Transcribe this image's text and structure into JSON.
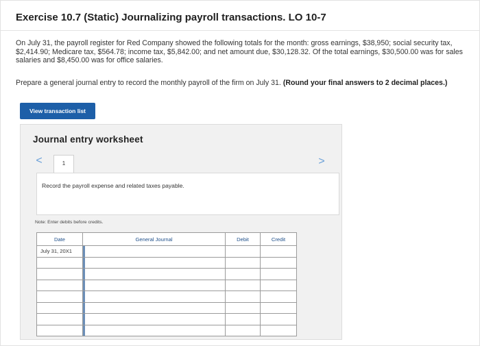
{
  "exercise": {
    "title": "Exercise 10.7 (Static) Journalizing payroll transactions. LO 10-7",
    "paragraph1": "On July 31, the payroll register for Red Company showed the following totals for the month: gross earnings, $38,950; social security tax, $2,414.90; Medicare tax, $564.78; income tax, $5,842.00; and net amount due, $30,128.32. Of the total earnings, $30,500.00 was for sales salaries and $8,450.00 was for office salaries.",
    "paragraph2": "Prepare a general journal entry to record the monthly payroll of the firm on July 31.",
    "paragraph2_bold": "(Round your final answers to 2 decimal places.)",
    "view_button": "View transaction list"
  },
  "worksheet": {
    "title": "Journal entry worksheet",
    "prev_symbol": "<",
    "next_symbol": ">",
    "tab_label": "1",
    "instruction": "Record the payroll expense and related taxes payable.",
    "note": "Note: Enter debits before credits.",
    "columns": {
      "date": "Date",
      "account": "General Journal",
      "debit": "Debit",
      "credit": "Credit"
    },
    "rows": [
      {
        "date": "July 31, 20X1",
        "account": "",
        "debit": "",
        "credit": ""
      },
      {
        "date": "",
        "account": "",
        "debit": "",
        "credit": ""
      },
      {
        "date": "",
        "account": "",
        "debit": "",
        "credit": ""
      },
      {
        "date": "",
        "account": "",
        "debit": "",
        "credit": ""
      },
      {
        "date": "",
        "account": "",
        "debit": "",
        "credit": ""
      },
      {
        "date": "",
        "account": "",
        "debit": "",
        "credit": ""
      },
      {
        "date": "",
        "account": "",
        "debit": "",
        "credit": ""
      },
      {
        "date": "",
        "account": "",
        "debit": "",
        "credit": ""
      }
    ]
  }
}
